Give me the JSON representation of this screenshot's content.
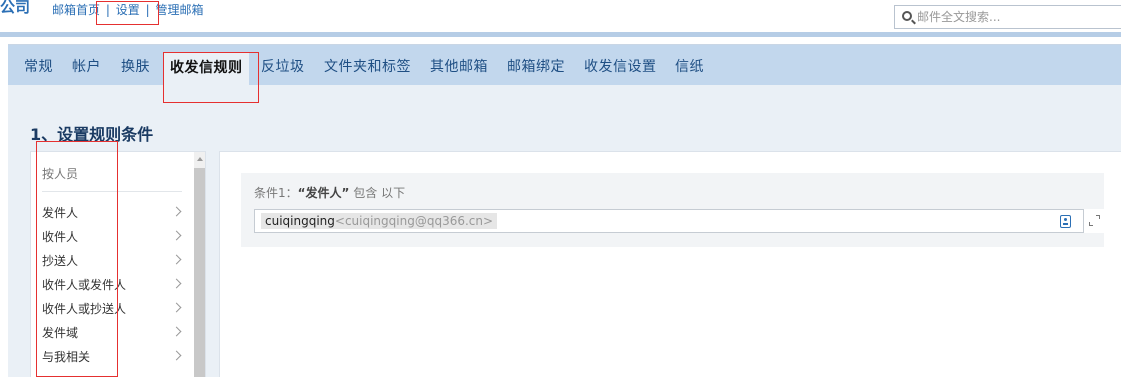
{
  "header": {
    "logo_fragment": "公司",
    "links": [
      "邮箱首页",
      "设置",
      "管理邮箱"
    ],
    "separator": "|"
  },
  "search": {
    "placeholder": "邮件全文搜索..."
  },
  "tabs": [
    {
      "label": "常规",
      "active": false
    },
    {
      "label": "帐户",
      "active": false
    },
    {
      "label": "换肤",
      "active": false
    },
    {
      "label": "收发信规则",
      "active": true
    },
    {
      "label": "反垃圾",
      "active": false
    },
    {
      "label": "文件夹和标签",
      "active": false
    },
    {
      "label": "其他邮箱",
      "active": false
    },
    {
      "label": "邮箱绑定",
      "active": false
    },
    {
      "label": "收发信设置",
      "active": false
    },
    {
      "label": "信纸",
      "active": false
    }
  ],
  "section": {
    "title": "1、设置规则条件"
  },
  "condition_list": {
    "heading": "按人员",
    "items": [
      "发件人",
      "收件人",
      "抄送人",
      "收件人或发件人",
      "收件人或抄送人",
      "发件域",
      "与我相关"
    ]
  },
  "condition": {
    "prefix": "条件1：",
    "field_open": "“",
    "field": "发件人",
    "field_close": "”",
    "suffix": " 包含 以下",
    "chip_name": "cuiqingqing",
    "chip_address": "<cuiqingqing@qq366.cn>"
  },
  "colors": {
    "accent": "#2b6fb5",
    "tabbar": "#c2d7ed",
    "panel": "#eaf0f6",
    "highlight": "#e53030"
  }
}
